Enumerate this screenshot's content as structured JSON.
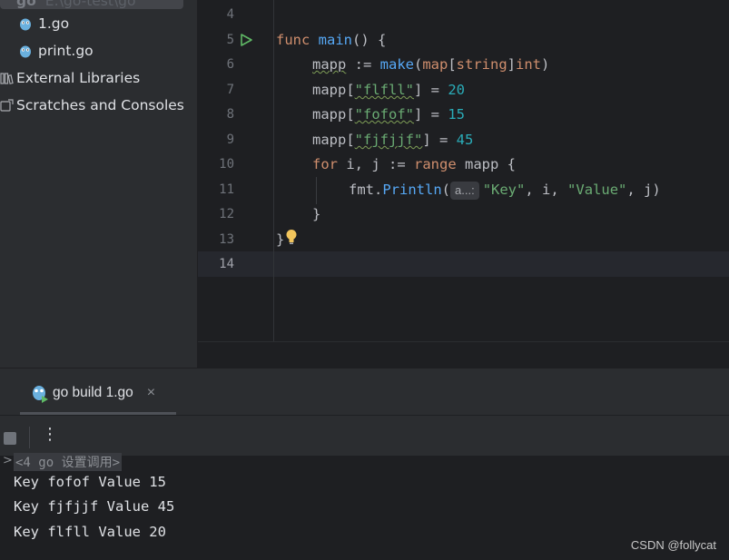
{
  "project": {
    "cutoff_row": {
      "name": "go",
      "path": "E:\\go-test\\go"
    },
    "files": [
      {
        "label": "1.go"
      },
      {
        "label": "print.go"
      }
    ],
    "external_libraries": "External Libraries",
    "scratches": "Scratches and Consoles"
  },
  "editor": {
    "line_numbers": [
      "4",
      "5",
      "6",
      "7",
      "8",
      "9",
      "10",
      "11",
      "12",
      "13",
      "14"
    ],
    "lines": {
      "l5": {
        "kw": "func",
        "name": "main",
        "rest": "() {"
      },
      "l6": {
        "var": "mapp",
        "op": " := ",
        "fn": "make",
        "p1": "(",
        "map": "map",
        "b1": "[",
        "string": "string",
        "b2": "]",
        "int": "int",
        "p2": ")"
      },
      "l7": {
        "var": "mapp",
        "open": "[",
        "str": "\"flfll\"",
        "close": "] = ",
        "num": "20"
      },
      "l8": {
        "var": "mapp",
        "open": "[",
        "str": "\"fofof\"",
        "close": "] = ",
        "num": "15"
      },
      "l9": {
        "var": "mapp",
        "open": "[",
        "str": "\"fjfjjf\"",
        "close": "] = ",
        "num": "45"
      },
      "l10": {
        "kw1": "for",
        "mid": " i, j := ",
        "kw2": "range",
        "rest": " mapp {"
      },
      "l11": {
        "pkg": "fmt.",
        "fn": "Println",
        "open": "(",
        "hint": "a...:",
        "s1": "\"Key\"",
        "m1": ", i, ",
        "s2": "\"Value\"",
        "end": ", j)"
      },
      "l12": {
        "text": "}"
      },
      "l13": {
        "text": "}"
      }
    }
  },
  "run_panel": {
    "tab_label": "go build 1.go",
    "close_symbol": "×",
    "more_symbol": "⋮",
    "console_header": "<4 go 设置调用>",
    "output": [
      "Key fofof Value 15",
      "Key fjfjjf Value 45",
      "Key flfll Value 20"
    ]
  },
  "watermark": "CSDN @follycat"
}
